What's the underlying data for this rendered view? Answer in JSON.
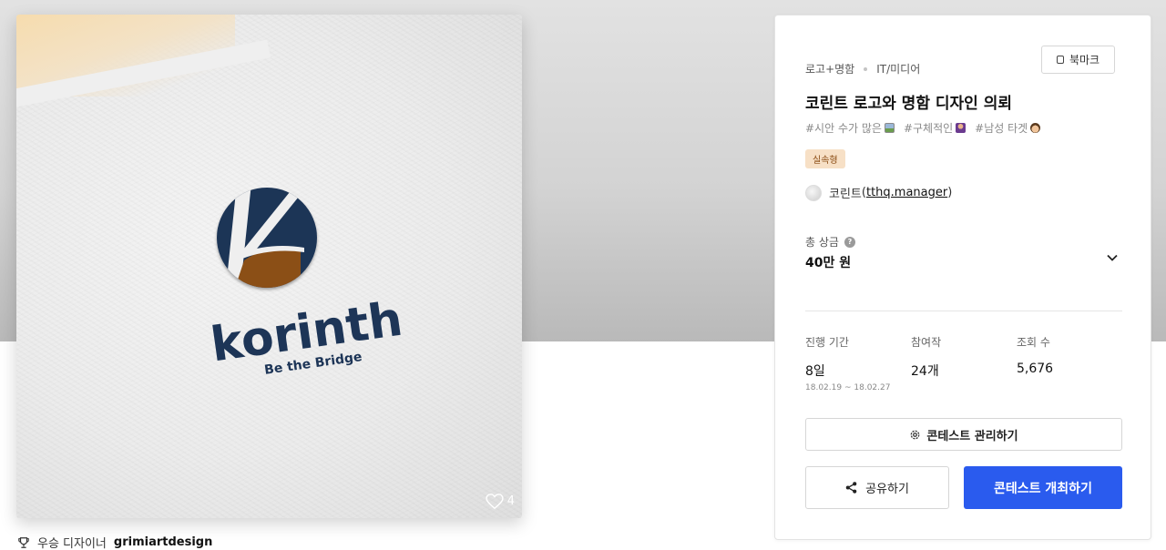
{
  "gallery": {
    "like_count": "4",
    "award_prefix": "우승 디자이너",
    "award_designer": "grimiartdesign",
    "logo_wordmark": "korinth",
    "logo_tagline": "Be the Bridge"
  },
  "contest": {
    "category": "로고+명함",
    "industry": "IT/미디어",
    "bookmark_label": "북마크",
    "title": "코린트 로고와 명함 디자인 의뢰",
    "tags": [
      "#시안 수가 많은",
      "#구체적인",
      "#남성 타겟"
    ],
    "type_badge": "실속형",
    "host_name": "코린트",
    "host_id": "tthq.manager",
    "prize_label": "총 상금",
    "prize_value": "40만 원",
    "stats": {
      "period_label": "진행 기간",
      "period_value": "8일",
      "period_start": "18.02.19",
      "period_sep": "~",
      "period_end": "18.02.27",
      "entries_label": "참여작",
      "entries_value": "24개",
      "views_label": "조회 수",
      "views_value": "5,676"
    },
    "manage_label": "콘테스트 관리하기",
    "share_label": "공유하기",
    "host_contest_label": "콘테스트 개최하기"
  },
  "colors": {
    "primary": "#2a5bee",
    "badge_bg": "#f7e0c6",
    "logo_navy": "#1d3557",
    "logo_brown": "#8b4f17"
  }
}
